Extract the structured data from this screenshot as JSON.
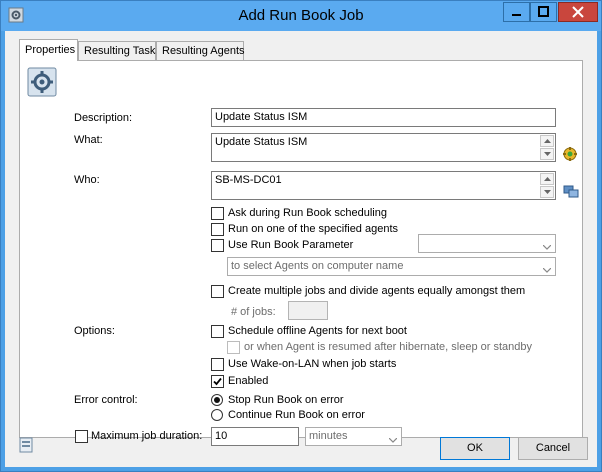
{
  "window": {
    "title": "Add Run Book Job",
    "app_icon": "gear-icon",
    "controls": {
      "minimize_icon": "minimize-icon",
      "maximize_icon": "maximize-icon",
      "close_icon": "close-icon"
    }
  },
  "tabs": [
    {
      "label": "Properties",
      "active": true
    },
    {
      "label": "Resulting Tasks",
      "active": false
    },
    {
      "label": "Resulting Agents",
      "active": false
    }
  ],
  "form": {
    "description": {
      "label": "Description:",
      "value": "Update Status ISM"
    },
    "what": {
      "label": "What:",
      "value": "Update Status ISM",
      "button_icon": "run-book-picker-icon"
    },
    "who": {
      "label": "Who:",
      "value": "SB-MS-DC01",
      "button_icon": "computers-picker-icon"
    },
    "ask_during_scheduling": {
      "label": "Ask during Run Book scheduling",
      "checked": false
    },
    "run_on_one_agent": {
      "label": "Run on one of the specified agents",
      "checked": false
    },
    "use_parameter": {
      "label": "Use Run Book Parameter",
      "checked": false,
      "select_value": ""
    },
    "agent_selector": {
      "value": "to select Agents on computer name"
    },
    "create_multiple_jobs": {
      "label": "Create multiple jobs and divide agents equally amongst them",
      "checked": false
    },
    "num_jobs": {
      "label": "# of jobs:",
      "value": ""
    },
    "options_label": "Options:",
    "schedule_offline": {
      "label": "Schedule offline Agents for next boot",
      "checked": false
    },
    "resume_hibernate": {
      "label": "or when Agent is resumed after hibernate, sleep or standby",
      "checked": false
    },
    "wake_on_lan": {
      "label": "Use Wake-on-LAN when job starts",
      "checked": false
    },
    "enabled": {
      "label": "Enabled",
      "checked": true
    },
    "error_control": {
      "label": "Error control:",
      "options": [
        {
          "label": "Stop Run Book on error",
          "selected": true
        },
        {
          "label": "Continue Run Book on error",
          "selected": false
        }
      ]
    },
    "max_duration": {
      "label": "Maximum job duration:",
      "checked": false,
      "value": "10",
      "unit": "minutes"
    }
  },
  "footer": {
    "help_icon": "document-icon",
    "ok_label": "OK",
    "cancel_label": "Cancel"
  }
}
